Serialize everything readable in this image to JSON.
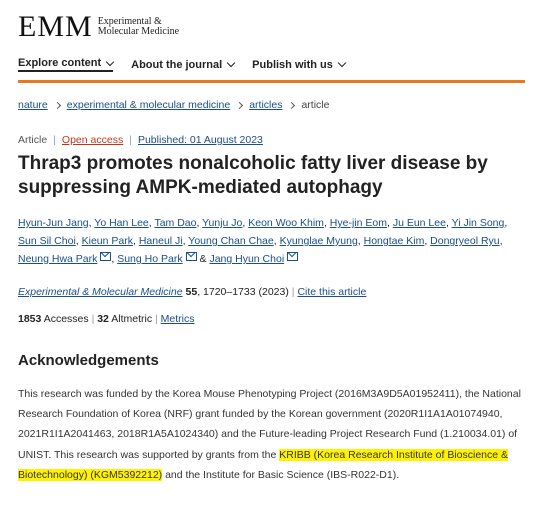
{
  "logo": {
    "mark": "EMM",
    "line1": "Experimental &",
    "line2": "Molecular Medicine"
  },
  "nav": [
    {
      "label": "Explore content"
    },
    {
      "label": "About the journal"
    },
    {
      "label": "Publish with us"
    }
  ],
  "breadcrumb": [
    "nature",
    "experimental & molecular medicine",
    "articles",
    "article"
  ],
  "meta": {
    "type": "Article",
    "access": "Open access",
    "published": "Published: 01 August 2023"
  },
  "article_title": "Thrap3 promotes nonalcoholic fatty liver disease by suppressing AMPK-mediated autophagy",
  "authors": [
    "Hyun-Jun Jang",
    "Yo Han Lee",
    "Tam Dao",
    "Yunju Jo",
    "Keon Woo Khim",
    "Hye-jin Eom",
    "Ju Eun Lee",
    "Yi Jin Song",
    "Sun Sil Choi",
    "Kieun Park",
    "Haneul Ji",
    "Young Chan Chae",
    "Kyunglae Myung",
    "Hongtae Kim",
    "Dongryeol Ryu",
    "Neung Hwa Park",
    "Sung Ho Park",
    "Jang Hyun Choi"
  ],
  "citation": {
    "journal": "Experimental & Molecular Medicine",
    "volume": "55",
    "pages": ", 1720–1733 (2023)",
    "cite_label": "Cite this article"
  },
  "metrics": {
    "accesses_count": "1853",
    "accesses_label": "Accesses",
    "altmetric_count": "32",
    "altmetric_label": "Altmetric",
    "metrics_link": "Metrics"
  },
  "ack": {
    "heading": "Acknowledgements",
    "text1": "This research was funded by the Korea Mouse Phenotyping Project (2016M3A9D5A01952411), the National Research Foundation of Korea (NRF) grant funded by the Korean government (2020R1I1A1A01074940, 2021R1I1A2041463, 2018R1A5A1024340) and the Future-leading Project Research Fund (1.210034.01) of UNIST. This research was supported by grants from the ",
    "highlight": "KRIBB (Korea Research Institute of Bioscience & Biotechnology) (KGM5392212)",
    "text2": " and the Institute for Basic Science (IBS-R022-D1)."
  },
  "colors": {
    "accent": "#e8791e",
    "link": "#1a4e8c",
    "open_access": "#c9331a",
    "highlight": "#fff200"
  }
}
